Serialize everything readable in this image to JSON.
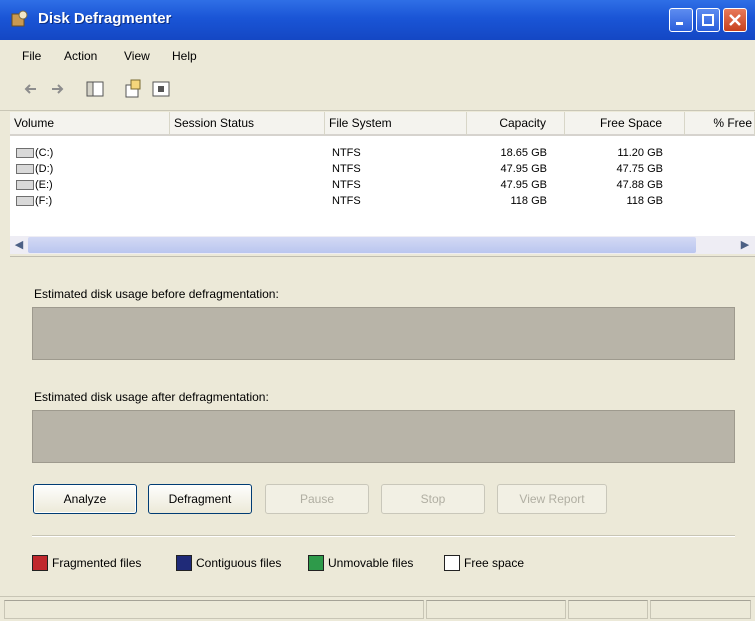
{
  "window": {
    "title": "Disk Defragmenter"
  },
  "menu": [
    "File",
    "Action",
    "View",
    "Help"
  ],
  "toolbar": {
    "icons": [
      "back-arrow-icon",
      "forward-arrow-icon",
      "console-tree-icon",
      "properties-icon",
      "help-icon"
    ]
  },
  "volumes": {
    "columns": [
      "Volume",
      "Session Status",
      "File System",
      "Capacity",
      "Free Space",
      "% Free"
    ],
    "rows": [
      {
        "volume": "(C:)",
        "status": "",
        "fs": "NTFS",
        "capacity": "18.65 GB",
        "free": "11.20 GB"
      },
      {
        "volume": "(D:)",
        "status": "",
        "fs": "NTFS",
        "capacity": "47.95 GB",
        "free": "47.75 GB"
      },
      {
        "volume": "(E:)",
        "status": "",
        "fs": "NTFS",
        "capacity": "47.95 GB",
        "free": "47.88 GB"
      },
      {
        "volume": "(F:)",
        "status": "",
        "fs": "NTFS",
        "capacity": "118 GB",
        "free": "118 GB"
      }
    ]
  },
  "usage": {
    "before_label": "Estimated disk usage before defragmentation:",
    "after_label": "Estimated disk usage after defragmentation:"
  },
  "buttons": {
    "analyze": "Analyze",
    "defragment": "Defragment",
    "pause": "Pause",
    "stop": "Stop",
    "view_report": "View Report"
  },
  "legend": [
    {
      "label": "Fragmented files",
      "color": "#c0282d"
    },
    {
      "label": "Contiguous files",
      "color": "#1f2a78"
    },
    {
      "label": "Unmovable files",
      "color": "#2e9a4a"
    },
    {
      "label": "Free space",
      "color": "#ffffff"
    }
  ]
}
